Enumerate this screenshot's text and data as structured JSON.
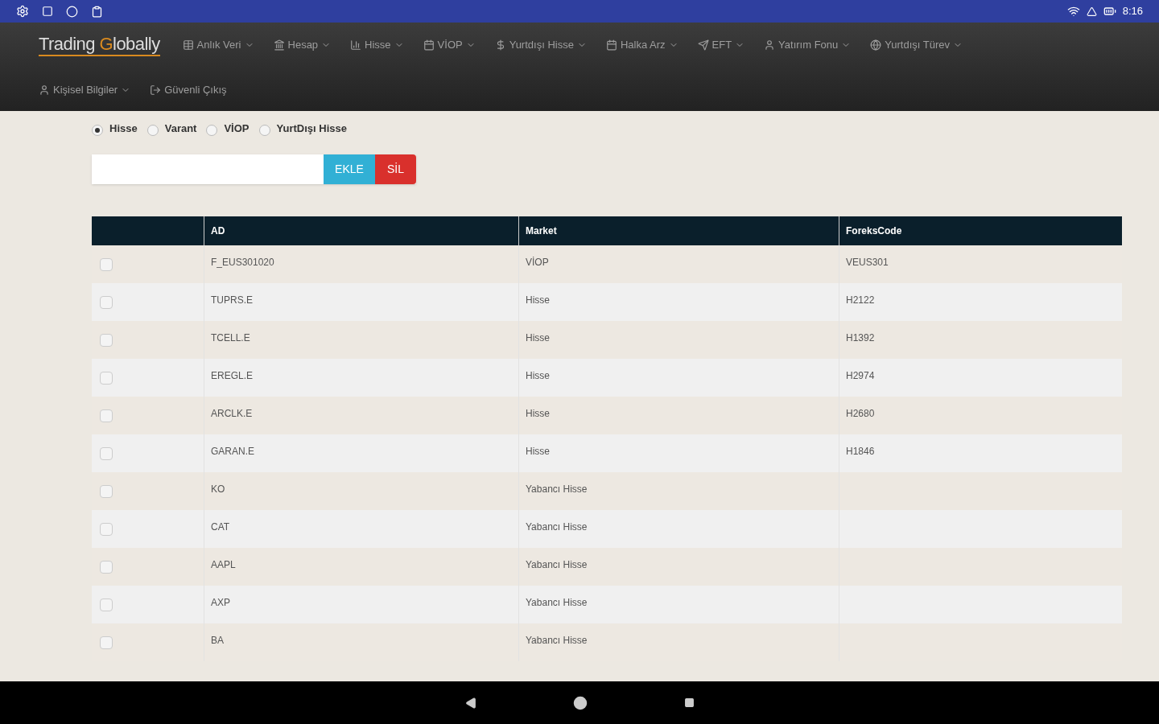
{
  "status_bar": {
    "time": "8:16"
  },
  "brand": {
    "before": "Trading ",
    "accent": "G",
    "after": "lobally"
  },
  "nav": [
    {
      "label": "Anlık Veri"
    },
    {
      "label": "Hesap"
    },
    {
      "label": "Hisse"
    },
    {
      "label": "VİOP"
    },
    {
      "label": "Yurtdışı Hisse"
    },
    {
      "label": "Halka Arz"
    },
    {
      "label": "EFT"
    },
    {
      "label": "Yatırım Fonu"
    },
    {
      "label": "Yurtdışı Türev"
    },
    {
      "label": "Kişisel Bilgiler"
    },
    {
      "label": "Güvenli Çıkış"
    }
  ],
  "market_options": [
    {
      "label": "Hisse",
      "selected": true
    },
    {
      "label": "Varant",
      "selected": false
    },
    {
      "label": "VİOP",
      "selected": false
    },
    {
      "label": "YurtDışı Hisse",
      "selected": false
    }
  ],
  "buttons": {
    "add": "EKLE",
    "delete": "SİL"
  },
  "table": {
    "columns": [
      "AD",
      "Market",
      "ForeksCode"
    ],
    "rows": [
      {
        "checked": false,
        "cells": [
          "F_EUS301020",
          "VİOP",
          "VEUS301"
        ]
      },
      {
        "checked": false,
        "cells": [
          "TUPRS.E",
          "Hisse",
          "H2122"
        ]
      },
      {
        "checked": false,
        "cells": [
          "TCELL.E",
          "Hisse",
          "H1392"
        ]
      },
      {
        "checked": false,
        "cells": [
          "EREGL.E",
          "Hisse",
          "H2974"
        ]
      },
      {
        "checked": false,
        "cells": [
          "ARCLK.E",
          "Hisse",
          "H2680"
        ]
      },
      {
        "checked": false,
        "cells": [
          "GARAN.E",
          "Hisse",
          "H1846"
        ]
      },
      {
        "checked": false,
        "cells": [
          "KO",
          "Yabancı Hisse",
          ""
        ]
      },
      {
        "checked": false,
        "cells": [
          "CAT",
          "Yabancı Hisse",
          ""
        ]
      },
      {
        "checked": false,
        "cells": [
          "AAPL",
          "Yabancı Hisse",
          ""
        ]
      },
      {
        "checked": false,
        "cells": [
          "AXP",
          "Yabancı Hisse",
          ""
        ]
      },
      {
        "checked": false,
        "cells": [
          "BA",
          "Yabancı Hisse",
          ""
        ]
      }
    ]
  }
}
